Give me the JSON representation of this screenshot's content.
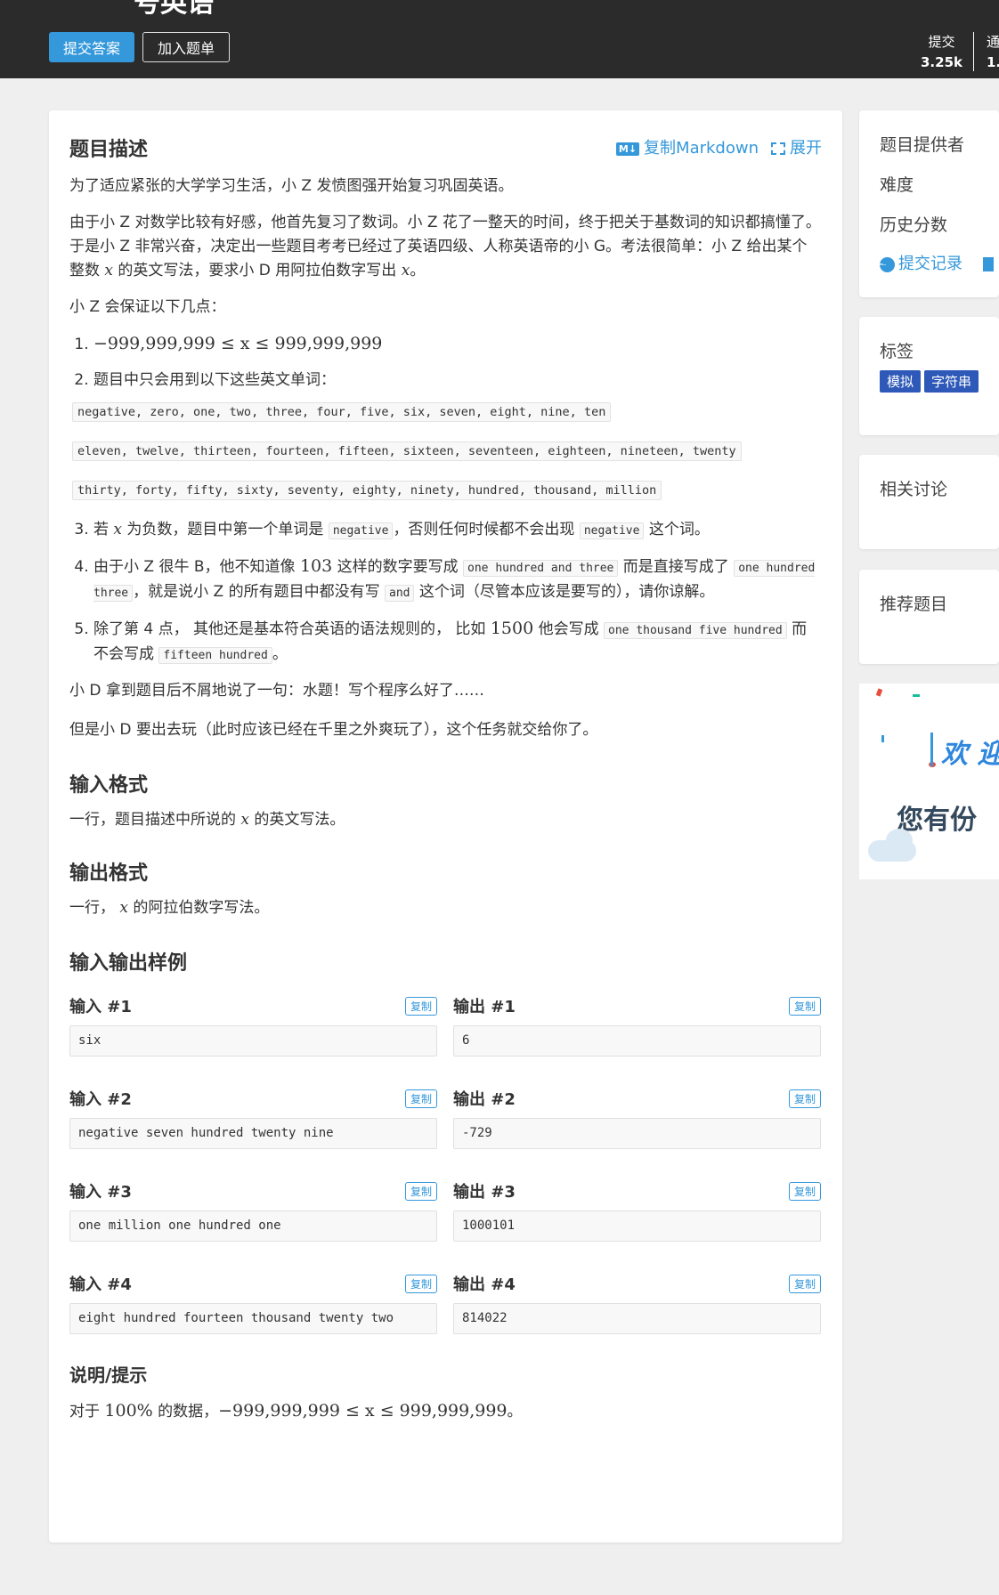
{
  "header": {
    "title_fragment": "号英语",
    "submit_label": "提交答案",
    "add_label": "加入题单",
    "stats": [
      {
        "label": "提交",
        "value": "3.25k"
      },
      {
        "label": "通",
        "value": "1."
      }
    ]
  },
  "problem": {
    "heading": "题目描述",
    "copy_markdown": "复制Markdown",
    "expand": "展开",
    "md_icon": "M↓",
    "intro": "为了适应紧张的大学学习生活，小 Z 发愤图强开始复习巩固英语。",
    "para2": "由于小 Z 对数学比较有好感，他首先复习了数词。小 Z 花了一整天的时间，终于把关于基数词的知识都搞懂了。于是小 Z 非常兴奋，决定出一些题目考考已经过了英语四级、人称英语帝的小 G。考法很简单：小 Z 给出某个整数",
    "para2_var": "x",
    "para2_end": "的英文写法，要求小 D 用阿拉伯数字写出",
    "para2_var2": "x",
    "para2_tail": "。",
    "guarantee": "小 Z 会保证以下几点：",
    "item1": "−999,999,999 ≤ x ≤ 999,999,999",
    "item2": "题目中只会用到以下这些英文单词：",
    "words1": "negative, zero, one, two, three, four, five, six, seven, eight, nine, ten",
    "words2": "eleven, twelve, thirteen, fourteen, fifteen, sixteen, seventeen, eighteen, nineteen, twenty",
    "words3": "thirty, forty, fifty, sixty, seventy, eighty, ninety, hundred, thousand, million",
    "item3_a": "若",
    "item3_var": "x",
    "item3_b": "为负数，题目中第一个单词是",
    "item3_code1": "negative",
    "item3_c": "，否则任何时候都不会出现",
    "item3_code2": "negative",
    "item3_d": "这个词。",
    "item4_a": "由于小 Z 很牛 B，他不知道像",
    "item4_num": "103",
    "item4_b": "这样的数字要写成",
    "item4_code1": "one hundred and three",
    "item4_c": "而是直接写成了",
    "item4_code2": "one hundred three",
    "item4_d": "，就是说小 Z 的所有题目中都没有写",
    "item4_code3": "and",
    "item4_e": "这个词（尽管本应该是要写的），请你谅解。",
    "item5_a": "除了第 4 点， 其他还是基本符合英语的语法规则的， 比如",
    "item5_num": "1500",
    "item5_b": "他会写成",
    "item5_code1": "one thousand five hundred",
    "item5_c": "而不会写成",
    "item5_code2": "fifteen hundred",
    "item5_d": "。",
    "para_d1": "小 D 拿到题目后不屑地说了一句：水题！写个程序么好了……",
    "para_d2": "但是小 D 要出去玩（此时应该已经在千里之外爽玩了），这个任务就交给你了。"
  },
  "input_format": {
    "heading": "输入格式",
    "text_a": "一行，题目描述中所说的",
    "var": "x",
    "text_b": "的英文写法。"
  },
  "output_format": {
    "heading": "输出格式",
    "text_a": "一行，",
    "var": "x",
    "text_b": "的阿拉伯数字写法。"
  },
  "samples": {
    "heading": "输入输出样例",
    "copy_label": "复制",
    "items": [
      {
        "in_title": "输入 #1",
        "in": "six",
        "out_title": "输出 #1",
        "out": "6"
      },
      {
        "in_title": "输入 #2",
        "in": "negative seven hundred twenty nine",
        "out_title": "输出 #2",
        "out": "-729"
      },
      {
        "in_title": "输入 #3",
        "in": "one million one hundred one",
        "out_title": "输出 #3",
        "out": "1000101"
      },
      {
        "in_title": "输入 #4",
        "in": "eight hundred fourteen thousand twenty two",
        "out_title": "输出 #4",
        "out": "814022"
      }
    ]
  },
  "hint": {
    "heading": "说明/提示",
    "text_a": "对于",
    "pct": "100%",
    "text_b": "的数据，",
    "range": "−999,999,999 ≤ x ≤ 999,999,999",
    "text_c": "。"
  },
  "sidebar": {
    "provider": "题目提供者",
    "difficulty": "难度",
    "history": "历史分数",
    "records": "提交记录",
    "tags_title": "标签",
    "tags": [
      {
        "name": "模拟",
        "color": "#2e59b8"
      },
      {
        "name": "字符串",
        "color": "#2e59b8"
      }
    ],
    "discussion": "相关讨论",
    "recommend": "推荐题目",
    "banner_line1": "欢 迎",
    "banner_line2": "您有份"
  },
  "colors": {
    "accent": "#3498db",
    "header_bg": "#2b2b2b",
    "tag": "#2e59b8"
  }
}
